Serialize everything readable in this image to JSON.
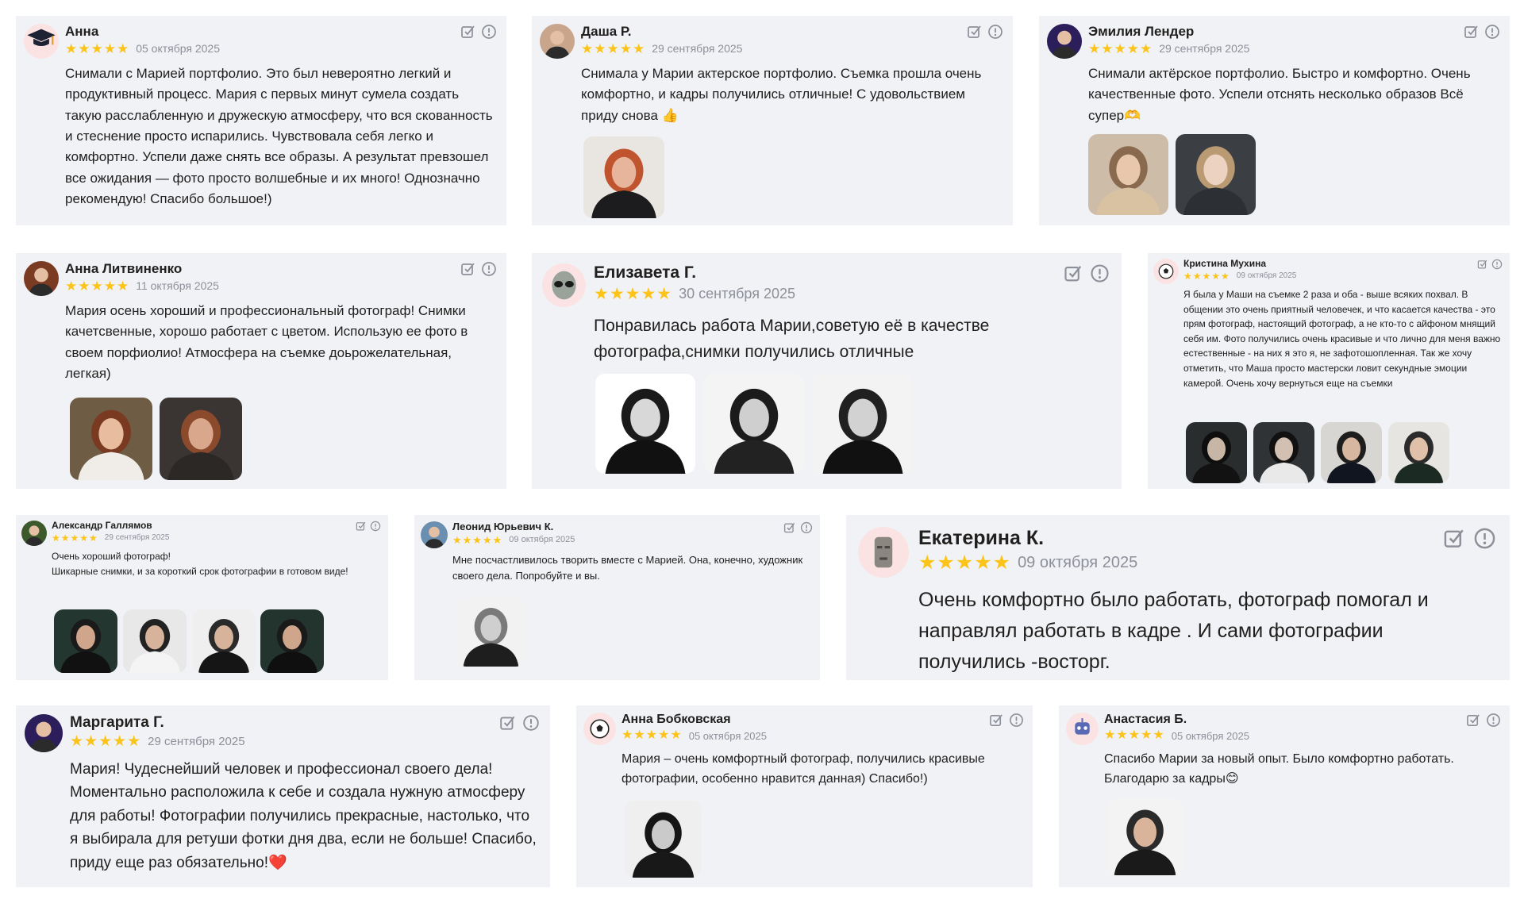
{
  "reviews": [
    {
      "name": "Анна",
      "date": "05 октября 2025",
      "stars": "★★★★★",
      "avatar_icon": "graduation-cap-icon",
      "text": "Снимали с Марией портфолио. Это был невероятно легкий и продуктивный процесс. Мария с первых минут сумела создать такую расслабленную и дружескую атмосферу, что вся скованность и стеснение просто испарились. Чувствовала себя легко и комфортно. Успели даже снять все образы. А результат превзошел все ожидания — фото просто волшебные и их много! Однозначно рекомендую! Спасибо большое!)"
    },
    {
      "name": "Даша Р.",
      "date": "29 сентября 2025",
      "stars": "★★★★★",
      "avatar_icon": "user-photo",
      "text": "Снимала у Марии актерское портфолио. Съемка прошла очень комфортно, и кадры получились отличные! С удовольствием приду снова 👍"
    },
    {
      "name": "Эмилия Лендер",
      "date": "29 сентября 2025",
      "stars": "★★★★★",
      "avatar_icon": "user-photo",
      "text": "Снимали актёрское портфолио. Быстро и комфортно. Очень качественные фото. Успели отснять несколько образов Всё супер🫶"
    },
    {
      "name": "Анна Литвиненко",
      "date": "11 октября 2025",
      "stars": "★★★★★",
      "avatar_icon": "user-photo",
      "text": "Мария осень хороший и профессиональный фотограф! Снимки качетсвенные, хорошо работает с цветом. Использую ее фото в своем порфиолио! Атмосфера на съемке доьрожелательная, легкая)"
    },
    {
      "name": "Елизавета Г.",
      "date": "30 сентября 2025",
      "stars": "★★★★★",
      "avatar_icon": "alien-icon",
      "text": "Понравилась работа Марии,советую её в качестве фотографа,снимки получились отличные"
    },
    {
      "name": "Кристина Мухина",
      "date": "09 октября 2025",
      "stars": "★★★★★",
      "avatar_icon": "soccer-ball-icon",
      "text": "Я была у Маши на съемке 2 раза и оба - выше всяких похвал. В общении это очень приятный человечек, и что касается качества - это прям фотограф, настоящий фотограф, а не кто-то с айфоном мнящий себя им. Фото получились очень красивые и что лично для меня важно естественные - на них я это я, не зафотошопленная. Так же хочу отметить, что Маша просто мастерски ловит секундные эмоции камерой. Очень хочу вернуться еще на съемки"
    },
    {
      "name": "Александр Галлямов",
      "date": "29 сентября 2025",
      "stars": "★★★★★",
      "avatar_icon": "user-photo",
      "text": "Очень хороший фотограф!\nШикарные снимки, и за короткий срок фотографии в готовом виде!"
    },
    {
      "name": "Леонид Юрьевич К.",
      "date": "09 октября 2025",
      "stars": "★★★★★",
      "avatar_icon": "user-photo",
      "text": "Мне посчастливилось творить вместе с Марией. Она, конечно, художник своего дела. Попробуйте и вы."
    },
    {
      "name": "Екатерина К.",
      "date": "09 октября 2025",
      "stars": "★★★★★",
      "avatar_icon": "moai-icon",
      "text": "Очень комфортно было работать, фотограф помогал и направлял работать в кадре . И сами фотографии получились -восторг."
    },
    {
      "name": "Маргарита Г.",
      "date": "29 сентября 2025",
      "stars": "★★★★★",
      "avatar_icon": "user-photo",
      "text": "Мария! Чудеснейший человек и профессионал своего дела! Моментально расположила к себе и создала нужную атмосферу для работы! Фотографии получились прекрасные, настолько, что я выбирала для ретуши фотки дня два, если не больше! Спасибо, приду еще раз обязательно!❤️"
    },
    {
      "name": "Анна Бобковская",
      "date": "05 октября 2025",
      "stars": "★★★★★",
      "avatar_icon": "soccer-ball-icon",
      "text": "Мария – очень комфортный фотограф, получились красивые фотографии, особенно нравится данная) Спасибо!)"
    },
    {
      "name": "Анастасия Б.",
      "date": "05 октября 2025",
      "stars": "★★★★★",
      "avatar_icon": "robot-icon",
      "text": "Спасибо Марии за новый опыт. Было комфортно работать. Благодарю за кадры😊"
    }
  ],
  "colors": {
    "card_bg": "#f1f2f6",
    "star": "#fcc419",
    "date": "#8d8f99",
    "text": "#21201f",
    "icon": "#8d8f99"
  }
}
